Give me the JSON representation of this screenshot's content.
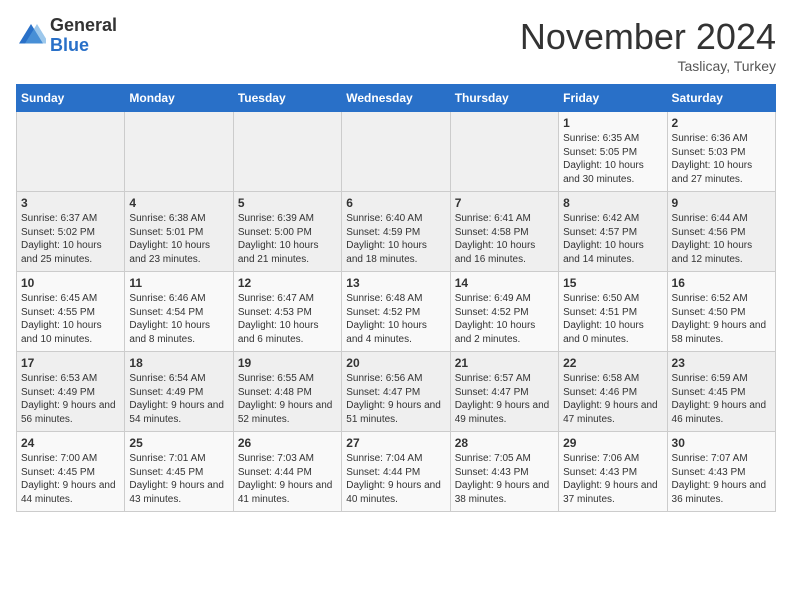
{
  "logo": {
    "general": "General",
    "blue": "Blue"
  },
  "header": {
    "month": "November 2024",
    "location": "Taslicay, Turkey"
  },
  "days_of_week": [
    "Sunday",
    "Monday",
    "Tuesday",
    "Wednesday",
    "Thursday",
    "Friday",
    "Saturday"
  ],
  "weeks": [
    [
      {
        "day": "",
        "info": ""
      },
      {
        "day": "",
        "info": ""
      },
      {
        "day": "",
        "info": ""
      },
      {
        "day": "",
        "info": ""
      },
      {
        "day": "",
        "info": ""
      },
      {
        "day": "1",
        "info": "Sunrise: 6:35 AM\nSunset: 5:05 PM\nDaylight: 10 hours and 30 minutes."
      },
      {
        "day": "2",
        "info": "Sunrise: 6:36 AM\nSunset: 5:03 PM\nDaylight: 10 hours and 27 minutes."
      }
    ],
    [
      {
        "day": "3",
        "info": "Sunrise: 6:37 AM\nSunset: 5:02 PM\nDaylight: 10 hours and 25 minutes."
      },
      {
        "day": "4",
        "info": "Sunrise: 6:38 AM\nSunset: 5:01 PM\nDaylight: 10 hours and 23 minutes."
      },
      {
        "day": "5",
        "info": "Sunrise: 6:39 AM\nSunset: 5:00 PM\nDaylight: 10 hours and 21 minutes."
      },
      {
        "day": "6",
        "info": "Sunrise: 6:40 AM\nSunset: 4:59 PM\nDaylight: 10 hours and 18 minutes."
      },
      {
        "day": "7",
        "info": "Sunrise: 6:41 AM\nSunset: 4:58 PM\nDaylight: 10 hours and 16 minutes."
      },
      {
        "day": "8",
        "info": "Sunrise: 6:42 AM\nSunset: 4:57 PM\nDaylight: 10 hours and 14 minutes."
      },
      {
        "day": "9",
        "info": "Sunrise: 6:44 AM\nSunset: 4:56 PM\nDaylight: 10 hours and 12 minutes."
      }
    ],
    [
      {
        "day": "10",
        "info": "Sunrise: 6:45 AM\nSunset: 4:55 PM\nDaylight: 10 hours and 10 minutes."
      },
      {
        "day": "11",
        "info": "Sunrise: 6:46 AM\nSunset: 4:54 PM\nDaylight: 10 hours and 8 minutes."
      },
      {
        "day": "12",
        "info": "Sunrise: 6:47 AM\nSunset: 4:53 PM\nDaylight: 10 hours and 6 minutes."
      },
      {
        "day": "13",
        "info": "Sunrise: 6:48 AM\nSunset: 4:52 PM\nDaylight: 10 hours and 4 minutes."
      },
      {
        "day": "14",
        "info": "Sunrise: 6:49 AM\nSunset: 4:52 PM\nDaylight: 10 hours and 2 minutes."
      },
      {
        "day": "15",
        "info": "Sunrise: 6:50 AM\nSunset: 4:51 PM\nDaylight: 10 hours and 0 minutes."
      },
      {
        "day": "16",
        "info": "Sunrise: 6:52 AM\nSunset: 4:50 PM\nDaylight: 9 hours and 58 minutes."
      }
    ],
    [
      {
        "day": "17",
        "info": "Sunrise: 6:53 AM\nSunset: 4:49 PM\nDaylight: 9 hours and 56 minutes."
      },
      {
        "day": "18",
        "info": "Sunrise: 6:54 AM\nSunset: 4:49 PM\nDaylight: 9 hours and 54 minutes."
      },
      {
        "day": "19",
        "info": "Sunrise: 6:55 AM\nSunset: 4:48 PM\nDaylight: 9 hours and 52 minutes."
      },
      {
        "day": "20",
        "info": "Sunrise: 6:56 AM\nSunset: 4:47 PM\nDaylight: 9 hours and 51 minutes."
      },
      {
        "day": "21",
        "info": "Sunrise: 6:57 AM\nSunset: 4:47 PM\nDaylight: 9 hours and 49 minutes."
      },
      {
        "day": "22",
        "info": "Sunrise: 6:58 AM\nSunset: 4:46 PM\nDaylight: 9 hours and 47 minutes."
      },
      {
        "day": "23",
        "info": "Sunrise: 6:59 AM\nSunset: 4:45 PM\nDaylight: 9 hours and 46 minutes."
      }
    ],
    [
      {
        "day": "24",
        "info": "Sunrise: 7:00 AM\nSunset: 4:45 PM\nDaylight: 9 hours and 44 minutes."
      },
      {
        "day": "25",
        "info": "Sunrise: 7:01 AM\nSunset: 4:45 PM\nDaylight: 9 hours and 43 minutes."
      },
      {
        "day": "26",
        "info": "Sunrise: 7:03 AM\nSunset: 4:44 PM\nDaylight: 9 hours and 41 minutes."
      },
      {
        "day": "27",
        "info": "Sunrise: 7:04 AM\nSunset: 4:44 PM\nDaylight: 9 hours and 40 minutes."
      },
      {
        "day": "28",
        "info": "Sunrise: 7:05 AM\nSunset: 4:43 PM\nDaylight: 9 hours and 38 minutes."
      },
      {
        "day": "29",
        "info": "Sunrise: 7:06 AM\nSunset: 4:43 PM\nDaylight: 9 hours and 37 minutes."
      },
      {
        "day": "30",
        "info": "Sunrise: 7:07 AM\nSunset: 4:43 PM\nDaylight: 9 hours and 36 minutes."
      }
    ]
  ]
}
